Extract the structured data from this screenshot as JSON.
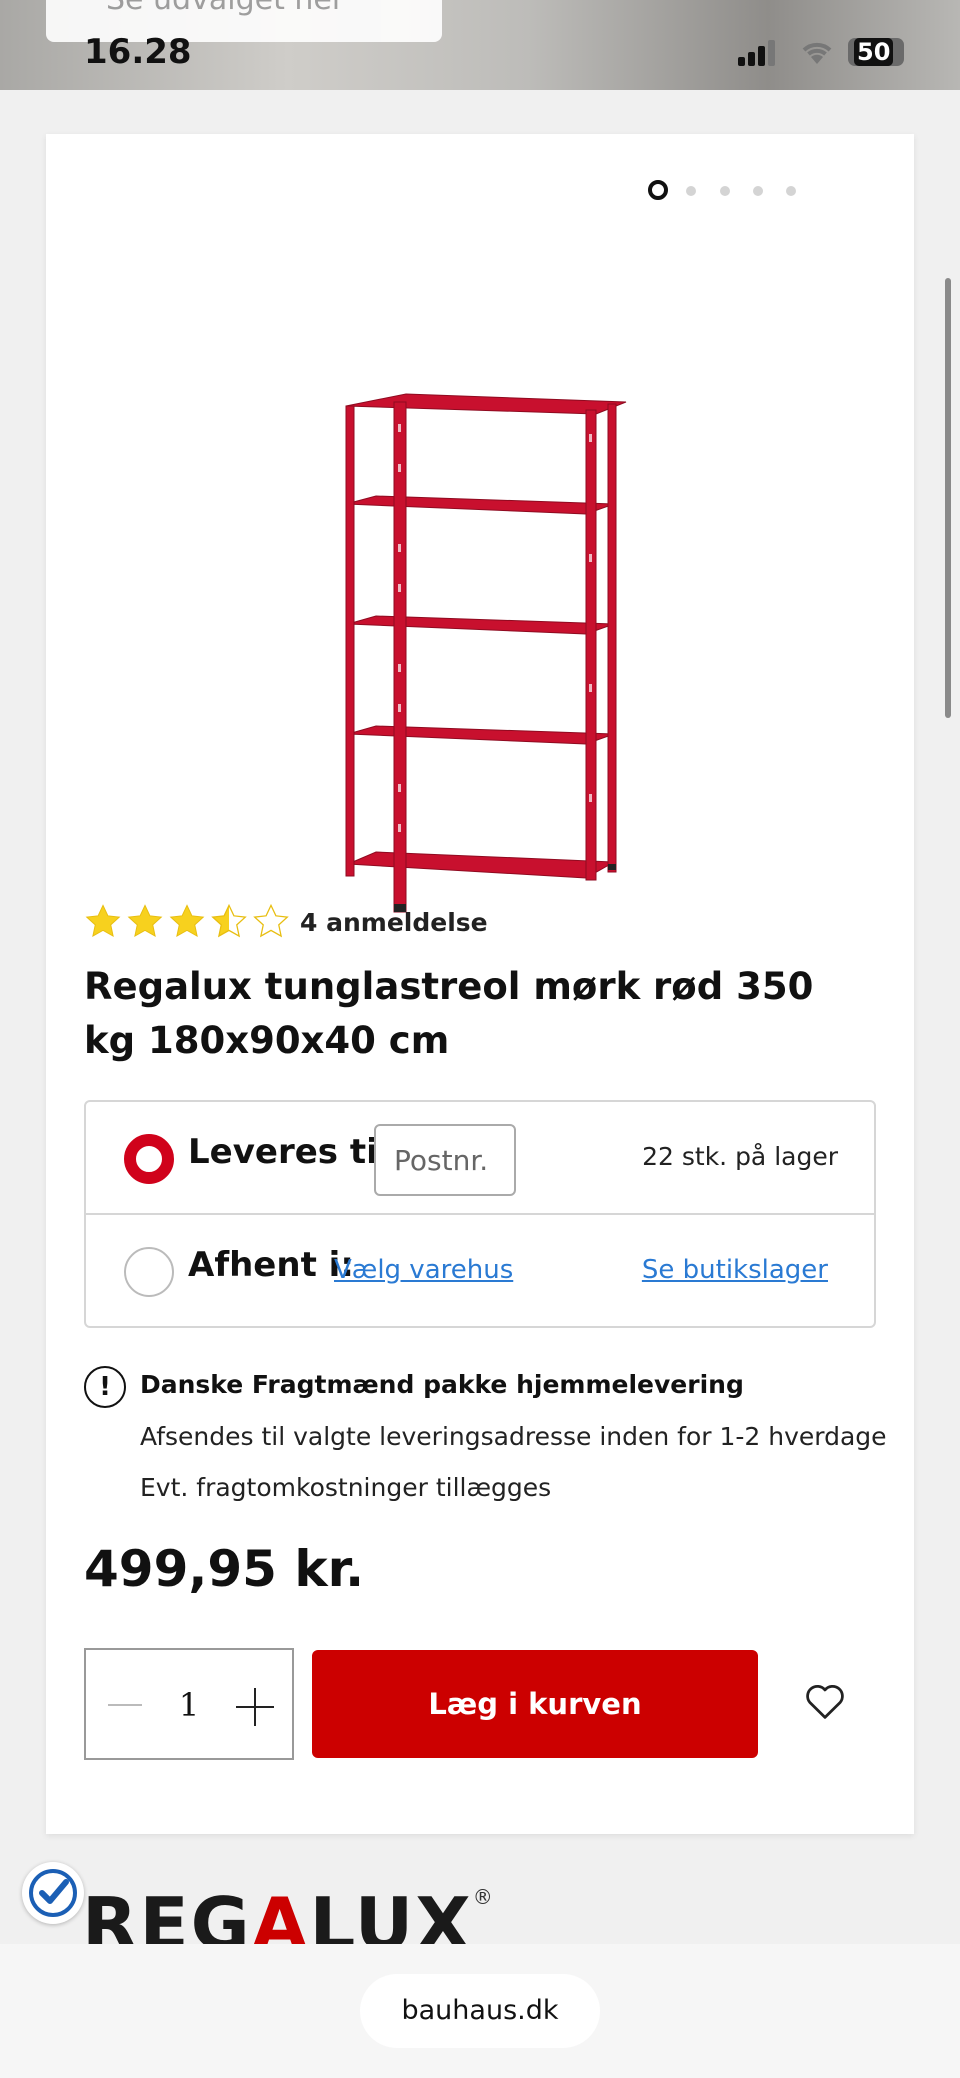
{
  "status_bar": {
    "time": "16.28",
    "battery": "50",
    "partial_button": "Se udvalget her"
  },
  "carousel": {
    "slides": 5,
    "active_index": 0
  },
  "product": {
    "image_color": "#c8102e",
    "rating": {
      "value": 3.5,
      "max": 5,
      "reviews_label": "4 anmeldelse"
    },
    "title": "Regalux tunglastreol mørk rød 350 kg 180x90x40 cm"
  },
  "delivery": {
    "deliver_label": "Leveres til:",
    "postcode_placeholder": "Postnr.",
    "stock": "22 stk. på lager",
    "pickup_label": "Afhent i:",
    "choose_store": "Vælg varehus",
    "store_stock": "Se butikslager",
    "selected": "deliver"
  },
  "shipping_info": {
    "title": "Danske Fragtmænd pakke hjemmelevering",
    "line1": "Afsendes til valgte leveringsadresse inden for 1-2 hverdage",
    "line2": "Evt. fragtomkostninger tillægges"
  },
  "price": "499,95 kr.",
  "quantity": "1",
  "add_to_cart": "Læg i kurven",
  "brand": {
    "part1": "REG",
    "part2": "A",
    "part3": "LUX",
    "registered": "®"
  },
  "browser": {
    "url": "bauhaus.dk"
  },
  "colors": {
    "accent_red": "#cc0000",
    "star_yellow": "#f7d11e",
    "link_blue": "#2a7ad3"
  }
}
